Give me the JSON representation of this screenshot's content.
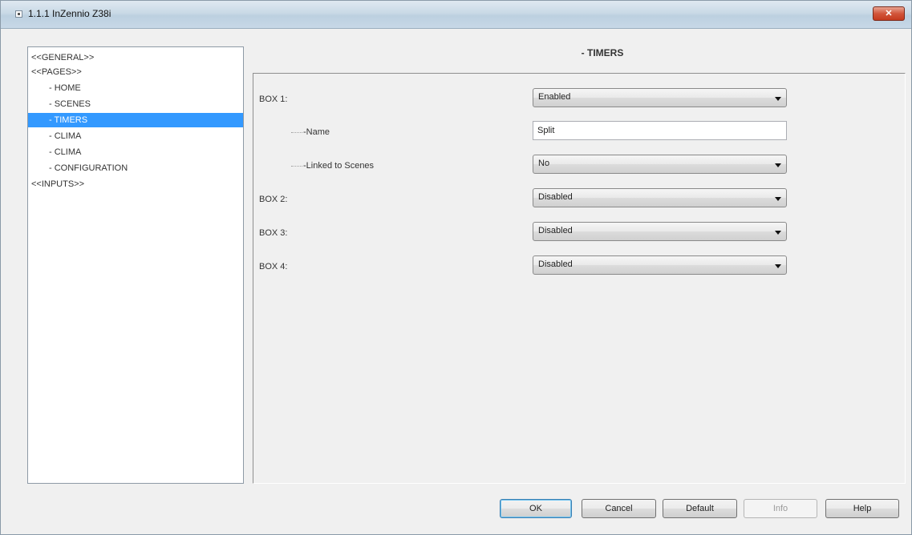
{
  "window": {
    "title": "1.1.1 InZennio Z38i",
    "close_label": "✕"
  },
  "tree": {
    "items": [
      {
        "label": "<<GENERAL>>",
        "selected": false
      },
      {
        "label": "<<PAGES>>",
        "selected": false
      },
      {
        "label": "- HOME",
        "selected": false
      },
      {
        "label": "- SCENES",
        "selected": false
      },
      {
        "label": "- TIMERS",
        "selected": true
      },
      {
        "label": "- CLIMA",
        "selected": false
      },
      {
        "label": "- CLIMA",
        "selected": false
      },
      {
        "label": "- CONFIGURATION",
        "selected": false
      },
      {
        "label": "<<INPUTS>>",
        "selected": false
      }
    ]
  },
  "panel": {
    "title": "- TIMERS",
    "box1_label": "BOX 1:",
    "box1_value": "Enabled",
    "name_label": "-Name",
    "name_value": "Split",
    "linked_label": "-Linked to Scenes",
    "linked_value": "No",
    "box2_label": "BOX 2:",
    "box2_value": "Disabled",
    "box3_label": "BOX 3:",
    "box3_value": "Disabled",
    "box4_label": "BOX 4:",
    "box4_value": "Disabled"
  },
  "buttons": {
    "ok": "OK",
    "cancel": "Cancel",
    "default": "Default",
    "info": "Info",
    "help": "Help"
  },
  "colors": {
    "selection": "#3399ff",
    "close_button": "#c53a1e"
  }
}
